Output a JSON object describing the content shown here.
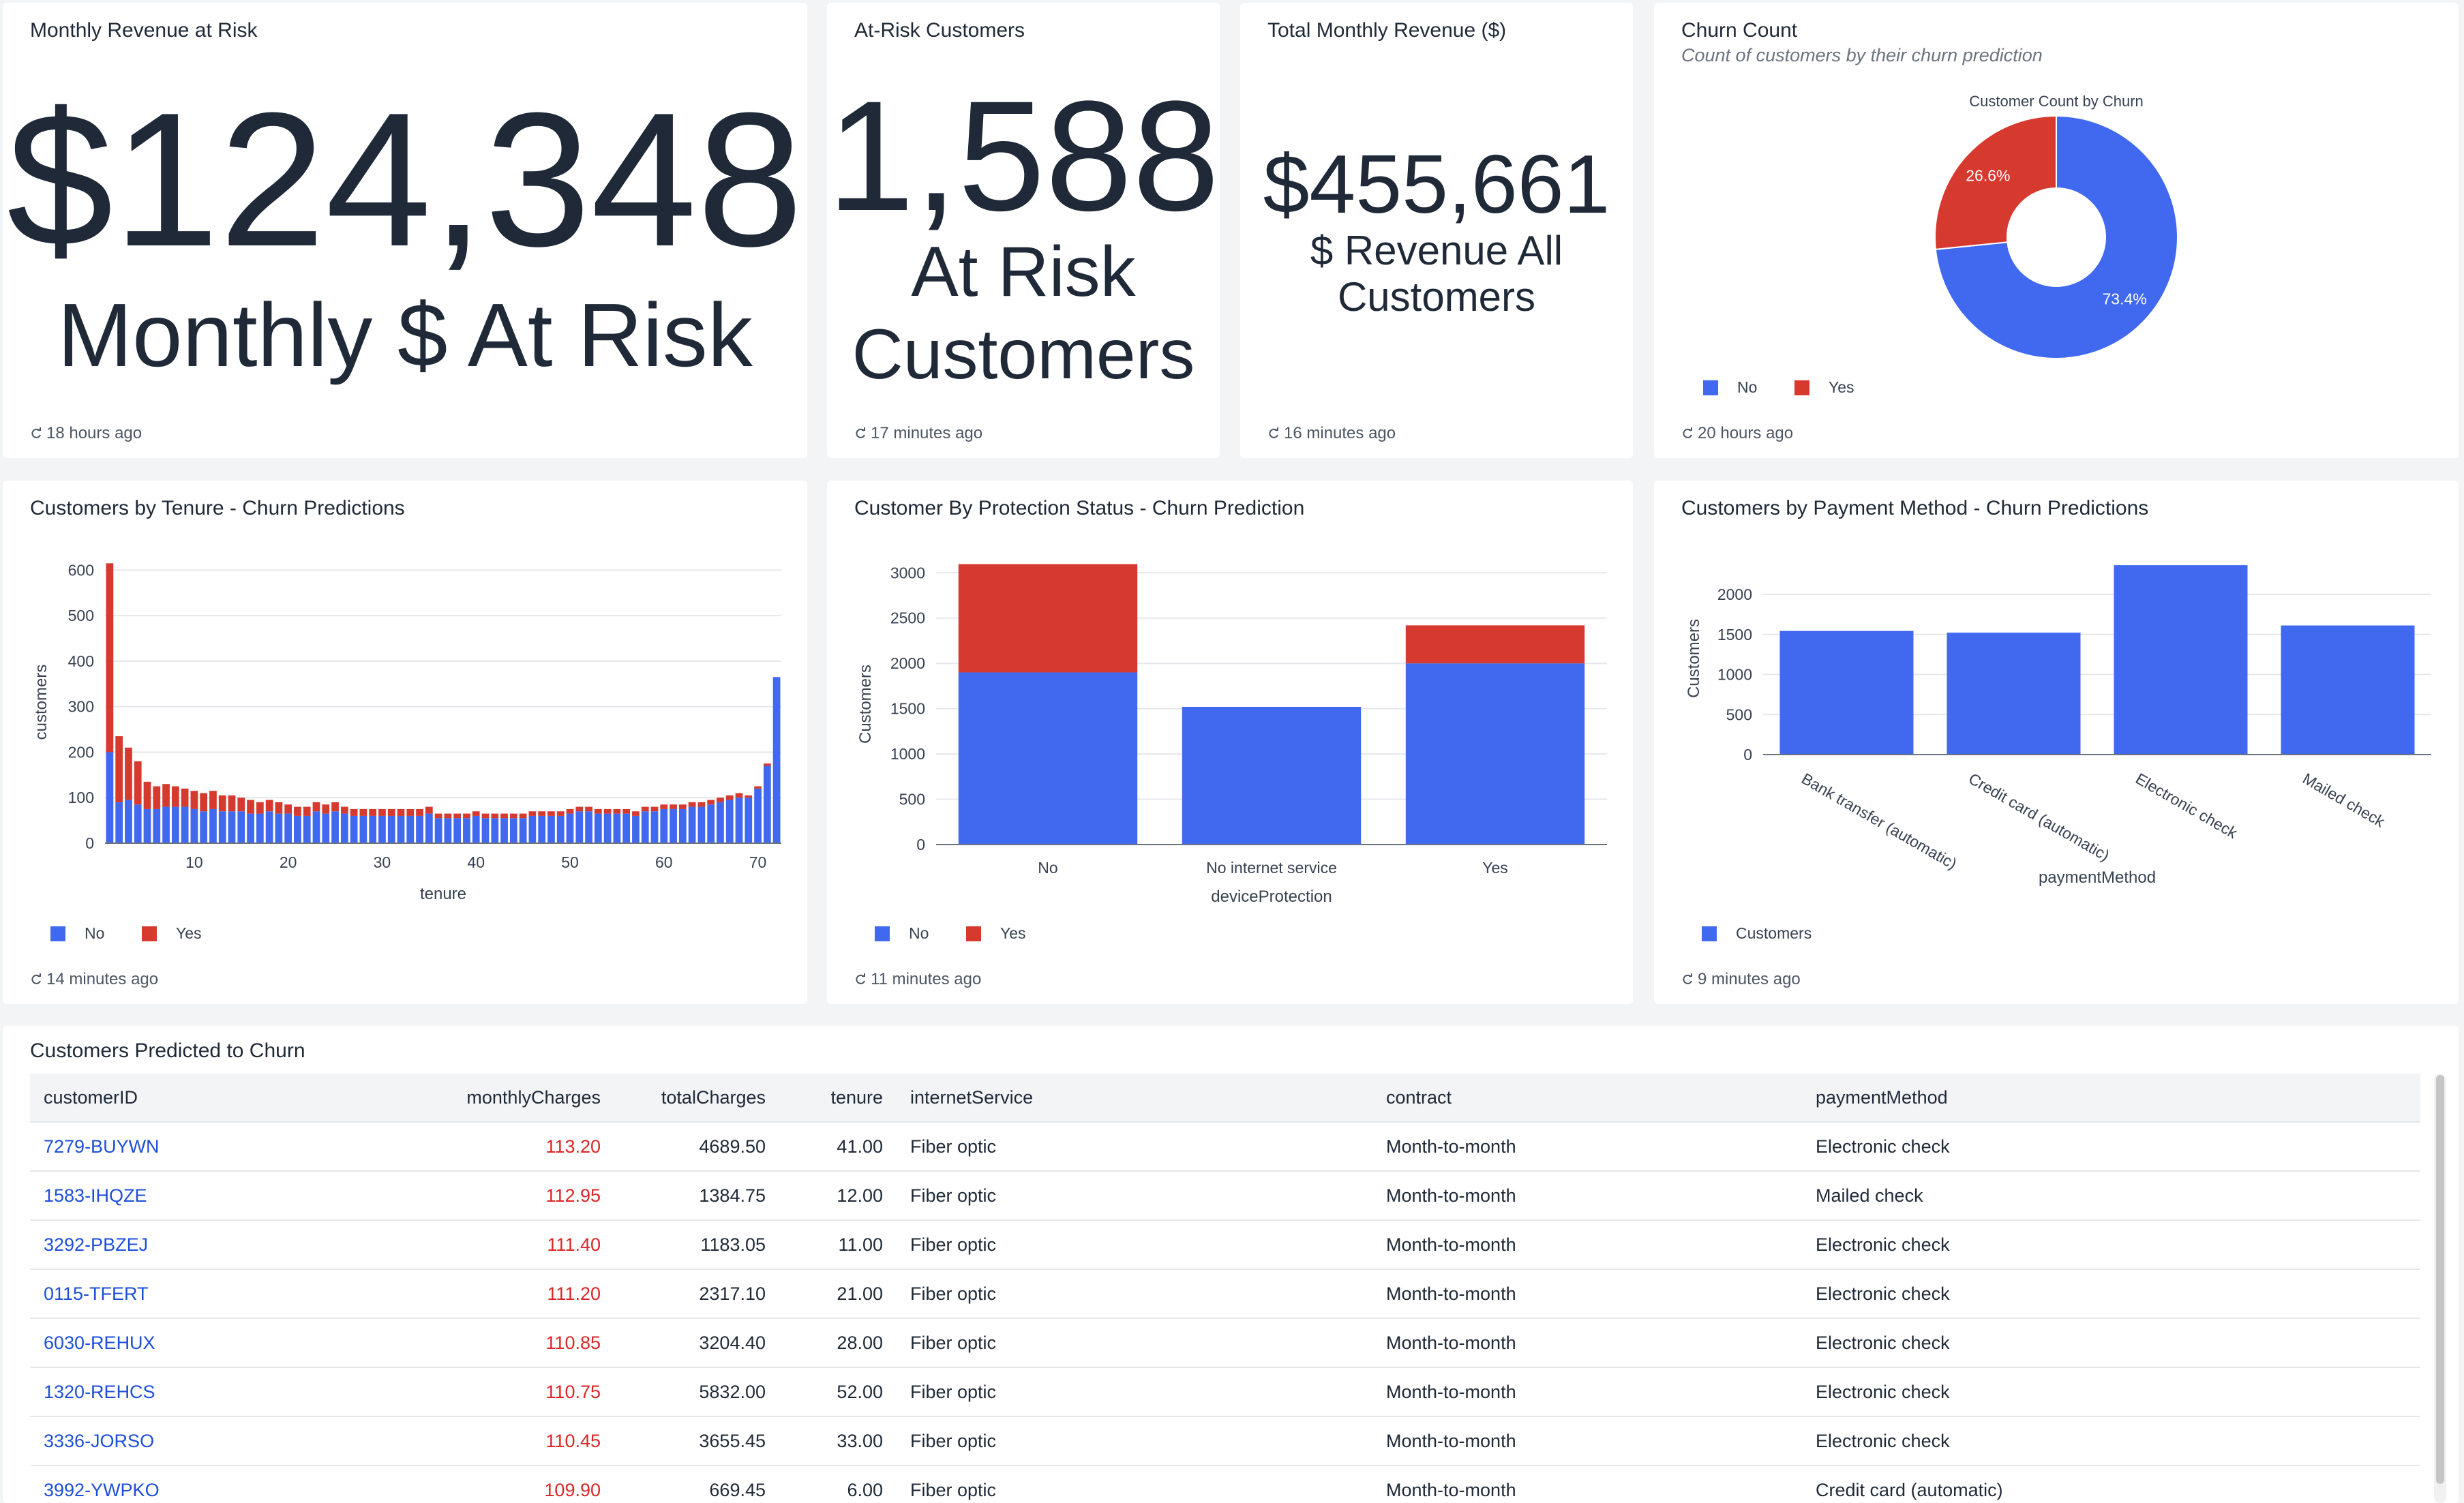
{
  "kpi_revenue_risk": {
    "title": "Monthly Revenue at Risk",
    "value": "$124,348",
    "label": "Monthly $ At Risk",
    "updated": "18 hours ago"
  },
  "kpi_at_risk": {
    "title": "At-Risk Customers",
    "value": "1,588",
    "label_line1": "At Risk",
    "label_line2": "Customers",
    "updated": "17 minutes ago"
  },
  "kpi_total_revenue": {
    "title": "Total Monthly Revenue ($)",
    "value": "$455,661",
    "label_line1": "$ Revenue All",
    "label_line2": "Customers",
    "updated": "16 minutes ago"
  },
  "churn_count": {
    "title": "Churn Count",
    "subtitle": "Count of customers by their churn prediction",
    "updated": "20 hours ago",
    "legend": [
      "No",
      "Yes"
    ]
  },
  "tenure_chart": {
    "title": "Customers by Tenure - Churn Predictions",
    "updated": "14 minutes ago"
  },
  "protection_chart": {
    "title": "Customer By Protection Status - Churn Prediction",
    "updated": "11 minutes ago"
  },
  "payment_chart": {
    "title": "Customers by Payment Method - Churn Predictions",
    "updated": "9 minutes ago"
  },
  "colors": {
    "no": "#4169f0",
    "yes": "#d63a2f",
    "link": "#1d4ed8",
    "charge": "#dc2626"
  },
  "chart_data": [
    {
      "type": "pie",
      "title": "Customer Count by Churn",
      "labels": [
        "No",
        "Yes"
      ],
      "values": [
        73.4,
        26.6
      ],
      "value_labels": [
        "73.4%",
        "26.6%"
      ],
      "legend_position": "bottom-left"
    },
    {
      "type": "bar",
      "stacked": true,
      "xlabel": "tenure",
      "ylabel": "customers",
      "x": [
        1,
        2,
        3,
        4,
        5,
        6,
        7,
        8,
        9,
        10,
        11,
        12,
        13,
        14,
        15,
        16,
        17,
        18,
        19,
        20,
        21,
        22,
        23,
        24,
        25,
        26,
        27,
        28,
        29,
        30,
        31,
        32,
        33,
        34,
        35,
        36,
        37,
        38,
        39,
        40,
        41,
        42,
        43,
        44,
        45,
        46,
        47,
        48,
        49,
        50,
        51,
        52,
        53,
        54,
        55,
        56,
        57,
        58,
        59,
        60,
        61,
        62,
        63,
        64,
        65,
        66,
        67,
        68,
        69,
        70,
        71,
        72
      ],
      "xticks": [
        10,
        20,
        30,
        40,
        50,
        60,
        70
      ],
      "ylim": [
        0,
        620
      ],
      "yticks": [
        0,
        100,
        200,
        300,
        400,
        500,
        600
      ],
      "series": [
        {
          "name": "No",
          "values": [
            200,
            90,
            95,
            85,
            75,
            75,
            80,
            80,
            80,
            75,
            70,
            75,
            70,
            70,
            70,
            65,
            65,
            70,
            65,
            65,
            60,
            60,
            70,
            65,
            70,
            65,
            60,
            60,
            60,
            60,
            60,
            60,
            60,
            60,
            65,
            55,
            55,
            55,
            55,
            60,
            55,
            55,
            55,
            55,
            55,
            60,
            60,
            60,
            60,
            65,
            70,
            70,
            65,
            65,
            65,
            65,
            60,
            70,
            70,
            75,
            75,
            75,
            80,
            80,
            85,
            90,
            95,
            100,
            100,
            120,
            170,
            365
          ]
        },
        {
          "name": "Yes",
          "values": [
            415,
            145,
            115,
            95,
            60,
            50,
            50,
            45,
            40,
            40,
            40,
            40,
            35,
            35,
            30,
            30,
            25,
            25,
            25,
            20,
            20,
            20,
            20,
            20,
            20,
            15,
            15,
            15,
            15,
            15,
            15,
            15,
            15,
            15,
            15,
            10,
            10,
            10,
            10,
            10,
            10,
            10,
            10,
            10,
            10,
            10,
            10,
            10,
            10,
            10,
            10,
            10,
            10,
            10,
            10,
            10,
            10,
            10,
            10,
            10,
            10,
            10,
            10,
            10,
            10,
            10,
            10,
            10,
            5,
            5,
            5,
            0
          ]
        }
      ],
      "legend_position": "bottom-left"
    },
    {
      "type": "bar",
      "stacked": true,
      "xlabel": "deviceProtection",
      "ylabel": "Customers",
      "categories": [
        "No",
        "No internet service",
        "Yes"
      ],
      "ylim": [
        0,
        3100
      ],
      "yticks": [
        0,
        500,
        1000,
        1500,
        2000,
        2500,
        3000
      ],
      "series": [
        {
          "name": "No",
          "values": [
            1900,
            1520,
            2000
          ]
        },
        {
          "name": "Yes",
          "values": [
            1195,
            0,
            420
          ]
        }
      ],
      "legend_position": "bottom-left"
    },
    {
      "type": "bar",
      "xlabel": "paymentMethod",
      "ylabel": "Customers",
      "categories": [
        "Bank transfer (automatic)",
        "Credit card (automatic)",
        "Electronic check",
        "Mailed check"
      ],
      "ylim": [
        0,
        2400
      ],
      "yticks": [
        0,
        500,
        1000,
        1500,
        2000
      ],
      "series": [
        {
          "name": "Customers",
          "values": [
            1544,
            1522,
            2365,
            1612
          ]
        }
      ],
      "legend_position": "bottom-left"
    }
  ],
  "churn_table": {
    "title": "Customers Predicted to Churn",
    "columns": [
      "customerID",
      "monthlyCharges",
      "totalCharges",
      "tenure",
      "internetService",
      "contract",
      "paymentMethod"
    ],
    "rows": [
      [
        "7279-BUYWN",
        "113.20",
        "4689.50",
        "41.00",
        "Fiber optic",
        "Month-to-month",
        "Electronic check"
      ],
      [
        "1583-IHQZE",
        "112.95",
        "1384.75",
        "12.00",
        "Fiber optic",
        "Month-to-month",
        "Mailed check"
      ],
      [
        "3292-PBZEJ",
        "111.40",
        "1183.05",
        "11.00",
        "Fiber optic",
        "Month-to-month",
        "Electronic check"
      ],
      [
        "0115-TFERT",
        "111.20",
        "2317.10",
        "21.00",
        "Fiber optic",
        "Month-to-month",
        "Electronic check"
      ],
      [
        "6030-REHUX",
        "110.85",
        "3204.40",
        "28.00",
        "Fiber optic",
        "Month-to-month",
        "Electronic check"
      ],
      [
        "1320-REHCS",
        "110.75",
        "5832.00",
        "52.00",
        "Fiber optic",
        "Month-to-month",
        "Electronic check"
      ],
      [
        "3336-JORSO",
        "110.45",
        "3655.45",
        "33.00",
        "Fiber optic",
        "Month-to-month",
        "Electronic check"
      ],
      [
        "3992-YWPKO",
        "109.90",
        "669.45",
        "6.00",
        "Fiber optic",
        "Month-to-month",
        "Credit card (automatic)"
      ]
    ]
  }
}
